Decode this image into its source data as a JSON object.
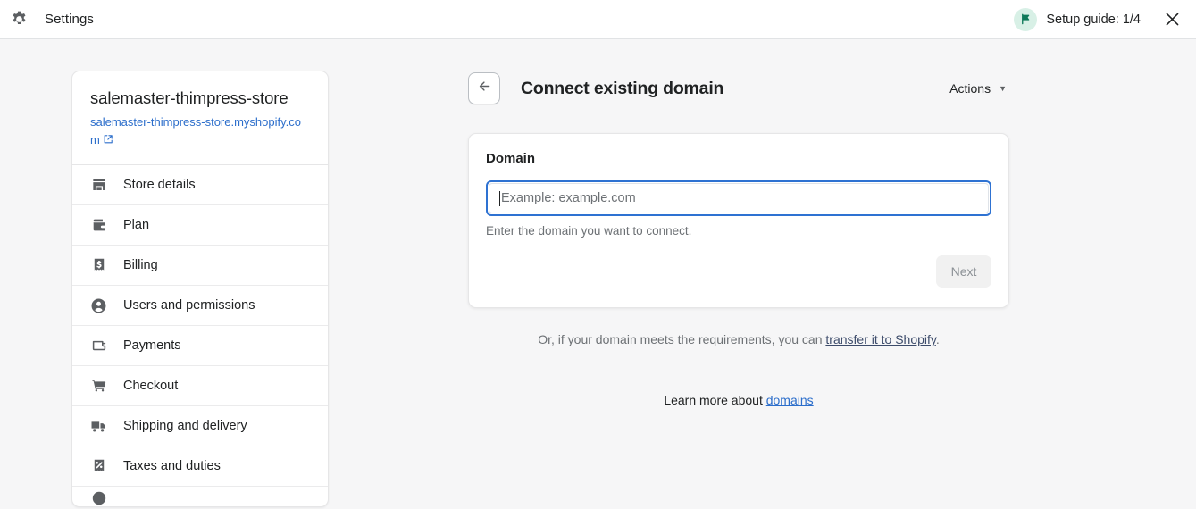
{
  "topbar": {
    "gear_icon": "gear-icon",
    "app_title": "Settings",
    "setup_guide_label": "Setup guide: 1/4",
    "setup_guide_icon": "flag-icon",
    "close_icon": "close-icon"
  },
  "sidebar": {
    "store_name": "salemaster-thimpress-store",
    "store_url": "salemaster-thimpress-store.myshopify.com",
    "external_link_icon": "external-link-icon",
    "items": [
      {
        "label": "Store details",
        "icon": "storefront-icon"
      },
      {
        "label": "Plan",
        "icon": "wallet-icon"
      },
      {
        "label": "Billing",
        "icon": "receipt-dollar-icon"
      },
      {
        "label": "Users and permissions",
        "icon": "person-icon"
      },
      {
        "label": "Payments",
        "icon": "credit-card-icon"
      },
      {
        "label": "Checkout",
        "icon": "shopping-cart-icon"
      },
      {
        "label": "Shipping and delivery",
        "icon": "delivery-truck-icon"
      },
      {
        "label": "Taxes and duties",
        "icon": "receipt-percent-icon"
      }
    ]
  },
  "main": {
    "back_icon": "arrow-left-icon",
    "page_title": "Connect existing domain",
    "actions_label": "Actions",
    "actions_caret_icon": "chevron-down-icon",
    "card": {
      "title": "Domain",
      "input_value": "",
      "input_placeholder": "Example: example.com",
      "help_text": "Enter the domain you want to connect.",
      "next_label": "Next"
    },
    "transfer_note_prefix": "Or, if your domain meets the requirements, you can ",
    "transfer_link": "transfer it to Shopify",
    "transfer_note_suffix": ".",
    "learn_more_prefix": "Learn more about ",
    "learn_more_link": "domains"
  },
  "colors": {
    "page_background": "#f6f6f7",
    "card_background": "#ffffff",
    "focus_ring": "#2e72d2",
    "link_blue": "#2c6ecb",
    "flag_green": "#0f7a5a",
    "flag_badge_background": "#d8f0e6",
    "disabled_button_background": "#f1f1f1",
    "muted_text": "#6d7175"
  }
}
